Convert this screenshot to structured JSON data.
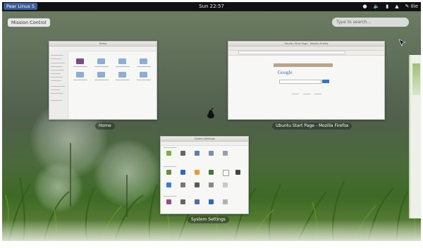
{
  "topbar": {
    "activities_label": "Pear Linux 5",
    "clock": "Sun 22:57",
    "tray": [
      {
        "icon": "accessibility-icon"
      },
      {
        "icon": "volume-icon"
      },
      {
        "icon": "battery-icon"
      },
      {
        "icon": "network-icon"
      },
      {
        "icon": "user-icon",
        "label": "Ilie"
      }
    ]
  },
  "overview": {
    "mission_control_label": "Mission Control",
    "search_placeholder": "Type to search..."
  },
  "windows": [
    {
      "title": "Home",
      "caption": "Home"
    },
    {
      "title": "Ubuntu Start Page - Mozilla Firefox",
      "caption": "Ubuntu Start Page - Mozilla Firefox",
      "page_logo": "Google"
    },
    {
      "title": "System Settings",
      "caption": "System Settings"
    }
  ],
  "colors": {
    "topbar_bg": "#111111",
    "activities_bg": "#3b5f96",
    "google_bar": "#3a75c4"
  }
}
